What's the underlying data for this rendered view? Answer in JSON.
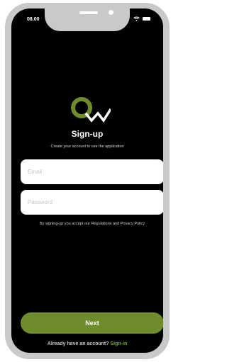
{
  "status_bar": {
    "time": "08.00",
    "icons": [
      "wifi-icon",
      "battery-icon"
    ]
  },
  "brand": {
    "logo": "qw-logo",
    "accent_color": "#6f8c2c"
  },
  "title": "Sign-up",
  "subtitle": "Create your account to use the application",
  "form": {
    "email_placeholder": "Email",
    "password_placeholder": "Password",
    "terms": "By signing-up you accept our Regulations and Privacy Policy"
  },
  "actions": {
    "next_label": "Next",
    "signin_prompt": "Already have an account?",
    "signin_link": "Sign-in"
  }
}
